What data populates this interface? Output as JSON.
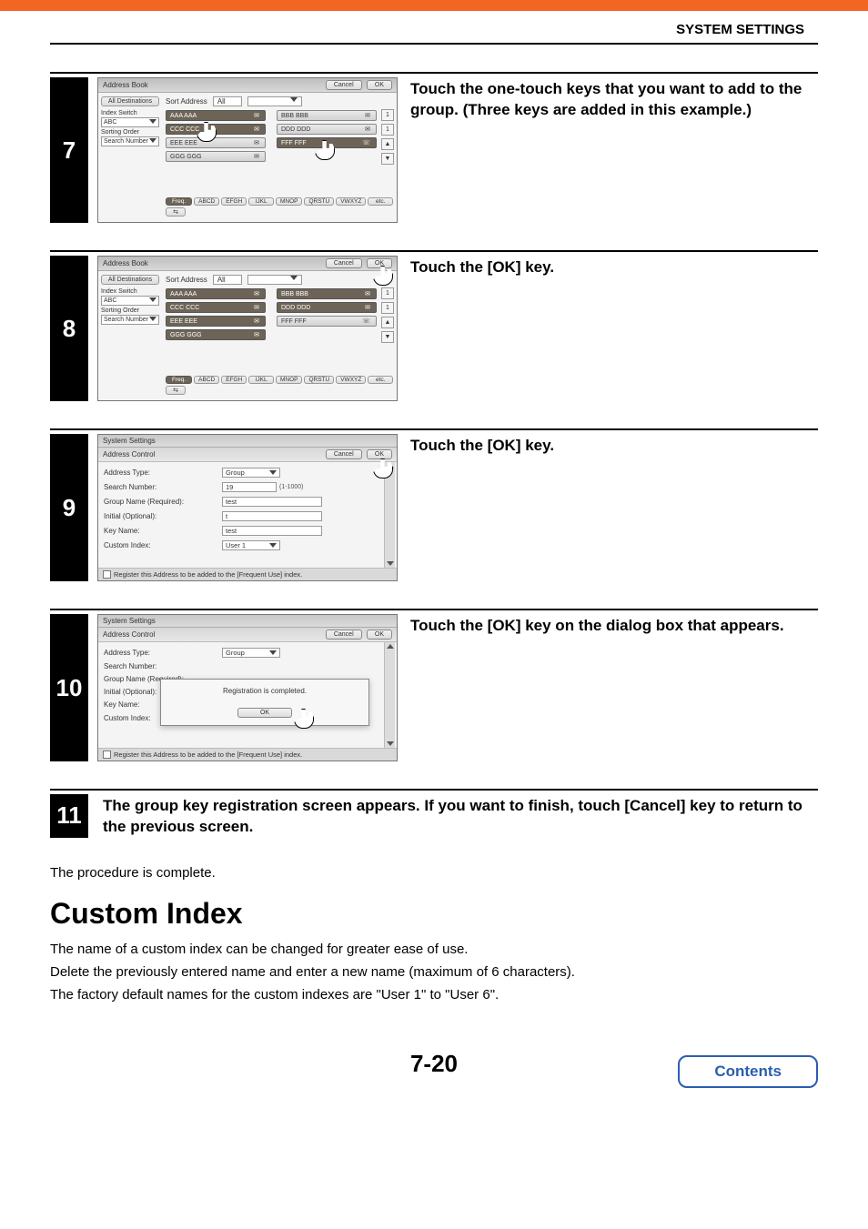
{
  "header": {
    "title": "SYSTEM SETTINGS"
  },
  "steps": {
    "s7": {
      "num": "7",
      "text": "Touch the one-touch keys that you want to add to the group. (Three keys are added in this example.)"
    },
    "s8": {
      "num": "8",
      "text": "Touch the [OK] key."
    },
    "s9": {
      "num": "9",
      "text": "Touch the [OK] key."
    },
    "s10": {
      "num": "10",
      "text": "Touch the [OK] key on the dialog box that appears."
    },
    "s11": {
      "num": "11",
      "text": "The group key registration screen appears. If you want to finish, touch [Cancel] key to return to the previous screen."
    }
  },
  "address_book": {
    "title": "Address Book",
    "cancel": "Cancel",
    "ok": "OK",
    "all_dest": "All Destinations",
    "sort_address": "Sort Address",
    "sort_value": "All",
    "index_switch_label": "Index Switch",
    "index_switch_value": "ABC",
    "sorting_label": "Sorting Order",
    "sorting_value": "Search Number",
    "keys": [
      "AAA AAA",
      "BBB BBB",
      "CCC CCC",
      "DDD DDD",
      "EEE EEE",
      "FFF FFF",
      "GGG GGG"
    ],
    "pages": [
      "1",
      "1"
    ],
    "tabs": [
      "Freq.",
      "ABCD",
      "EFGH",
      "IJKL",
      "MNOP",
      "QRSTU",
      "VWXYZ",
      "etc."
    ],
    "icon_tab": "�⇆"
  },
  "address_control": {
    "sys_title": "System Settings",
    "sub_title": "Address Control",
    "cancel": "Cancel",
    "ok": "OK",
    "rows": {
      "address_type": {
        "label": "Address Type:",
        "value": "Group"
      },
      "search_number": {
        "label": "Search Number:",
        "value": "19",
        "hint": "(1-1000)"
      },
      "group_name": {
        "label": "Group Name (Required):",
        "value": "test"
      },
      "initial": {
        "label": "Initial (Optional):",
        "value": "t"
      },
      "key_name": {
        "label": "Key Name:",
        "value": "test"
      },
      "custom_index": {
        "label": "Custom Index:",
        "value": "User 1"
      }
    },
    "footer": "Register this Address to be added to the [Frequent Use] index.",
    "modal": {
      "msg": "Registration is completed.",
      "ok": "OK"
    }
  },
  "post_complete": "The procedure is complete.",
  "section": {
    "title": "Custom Index",
    "p1": "The name of a custom index can be changed for greater ease of use.",
    "p2": "Delete the previously entered name and enter a new name (maximum of 6 characters).",
    "p3": "The factory default names for the custom indexes are \"User 1\" to \"User 6\"."
  },
  "footer": {
    "page": "7-20",
    "contents": "Contents"
  }
}
